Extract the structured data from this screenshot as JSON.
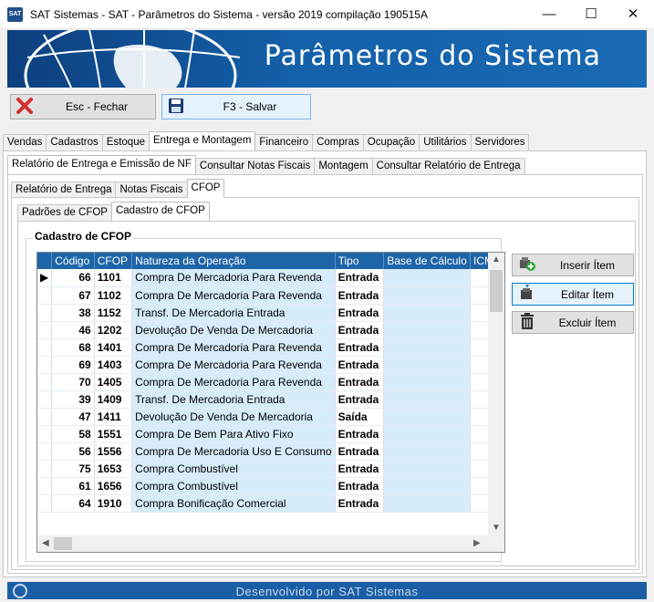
{
  "window": {
    "title": "SAT Sistemas - SAT - Parâmetros do Sistema - versão 2019 compilação 190515A",
    "app_icon_text": "SAT",
    "minimize": "—",
    "maximize": "☐",
    "close": "✕"
  },
  "banner": {
    "title": "Parâmetros do Sistema"
  },
  "toolbar": {
    "close_label": "Esc - Fechar",
    "save_label": "F3 - Salvar"
  },
  "main_tabs": [
    "Vendas",
    "Cadastros",
    "Estoque",
    "Entrega e Montagem",
    "Financeiro",
    "Compras",
    "Ocupação",
    "Utilitários",
    "Servidores"
  ],
  "main_tab_active": "Entrega e Montagem",
  "sub_tabs": [
    "Relatório de Entrega e Emissão de NF",
    "Consultar Notas Fiscais",
    "Montagem",
    "Consultar Relatório de Entrega"
  ],
  "sub_tab_active": "Relatório de Entrega e Emissão de NF",
  "sub2_tabs": [
    "Relatório de Entrega",
    "Notas Fiscais",
    "CFOP"
  ],
  "sub2_tab_active": "CFOP",
  "sub3_tabs": [
    "Padrões de CFOP",
    "Cadastro de CFOP"
  ],
  "sub3_tab_active": "Cadastro de CFOP",
  "group_title": "Cadastro de CFOP",
  "grid": {
    "columns": [
      "Código",
      "CFOP",
      "Natureza da Operação",
      "Tipo",
      "Base de Cálculo",
      "ICMS"
    ],
    "rows": [
      [
        "66",
        "1101",
        "Compra De Mercadoria Para Revenda",
        "Entrada",
        "",
        ""
      ],
      [
        "67",
        "1102",
        "Compra De Mercadoria Para Revenda",
        "Entrada",
        "",
        ""
      ],
      [
        "38",
        "1152",
        "Transf. De Mercadoria Entrada",
        "Entrada",
        "",
        ""
      ],
      [
        "46",
        "1202",
        "Devolução De Venda De Mercadoria",
        "Entrada",
        "",
        ""
      ],
      [
        "68",
        "1401",
        "Compra De Mercadoria Para Revenda",
        "Entrada",
        "",
        ""
      ],
      [
        "69",
        "1403",
        "Compra De Mercadoria Para Revenda",
        "Entrada",
        "",
        ""
      ],
      [
        "70",
        "1405",
        "Compra De Mercadoria Para Revenda",
        "Entrada",
        "",
        ""
      ],
      [
        "39",
        "1409",
        "Transf. De Mercadoria Entrada",
        "Entrada",
        "",
        ""
      ],
      [
        "47",
        "1411",
        "Devolução De Venda De Mercadoria",
        "Saída",
        "",
        ""
      ],
      [
        "58",
        "1551",
        "Compra De Bem Para Ativo Fixo",
        "Entrada",
        "",
        ""
      ],
      [
        "56",
        "1556",
        "Compra De Mercadoria Uso E Consumo",
        "Entrada",
        "",
        ""
      ],
      [
        "75",
        "1653",
        "Compra Combustível",
        "Entrada",
        "",
        ""
      ],
      [
        "61",
        "1656",
        "Compra Combustível",
        "Entrada",
        "",
        ""
      ],
      [
        "64",
        "1910",
        "Compra Bonificação Comercial",
        "Entrada",
        "",
        ""
      ]
    ],
    "selected_row": 0
  },
  "actions": {
    "insert_label": "Inserir Ítem",
    "edit_label": "Editar Ítem",
    "delete_label": "Excluir Ítem"
  },
  "footer": {
    "text": "Desenvolvido por SAT Sistemas"
  },
  "colors": {
    "banner": "#1460aa",
    "grid_header": "#1e65a8",
    "grid_alt_col": "#d7ecf9",
    "footer": "#1b5ea5",
    "close_x": "#d32f2f"
  }
}
